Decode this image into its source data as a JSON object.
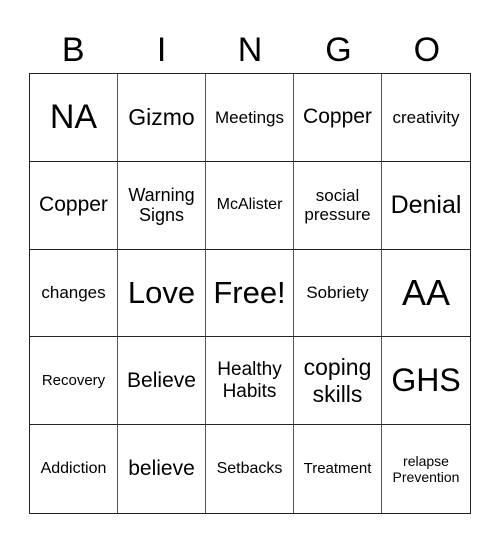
{
  "header": [
    "B",
    "I",
    "N",
    "G",
    "O"
  ],
  "cells": [
    {
      "text": "NA",
      "size": 34
    },
    {
      "text": "Gizmo",
      "size": 23
    },
    {
      "text": "Meetings",
      "size": 17
    },
    {
      "text": "Copper",
      "size": 21
    },
    {
      "text": "creativity",
      "size": 17
    },
    {
      "text": "Copper",
      "size": 21
    },
    {
      "text": "Warning Signs",
      "size": 18
    },
    {
      "text": "McAlister",
      "size": 16
    },
    {
      "text": "social pressure",
      "size": 17
    },
    {
      "text": "Denial",
      "size": 25
    },
    {
      "text": "changes",
      "size": 17
    },
    {
      "text": "Love",
      "size": 31
    },
    {
      "text": "Free!",
      "size": 31
    },
    {
      "text": "Sobriety",
      "size": 17
    },
    {
      "text": "AA",
      "size": 36
    },
    {
      "text": "Recovery",
      "size": 15
    },
    {
      "text": "Believe",
      "size": 21
    },
    {
      "text": "Healthy Habits",
      "size": 19
    },
    {
      "text": "coping skills",
      "size": 23
    },
    {
      "text": "GHS",
      "size": 32
    },
    {
      "text": "Addiction",
      "size": 16
    },
    {
      "text": "believe",
      "size": 21
    },
    {
      "text": "Setbacks",
      "size": 16
    },
    {
      "text": "Treatment",
      "size": 15
    },
    {
      "text": "relapse Prevention",
      "size": 14
    }
  ]
}
